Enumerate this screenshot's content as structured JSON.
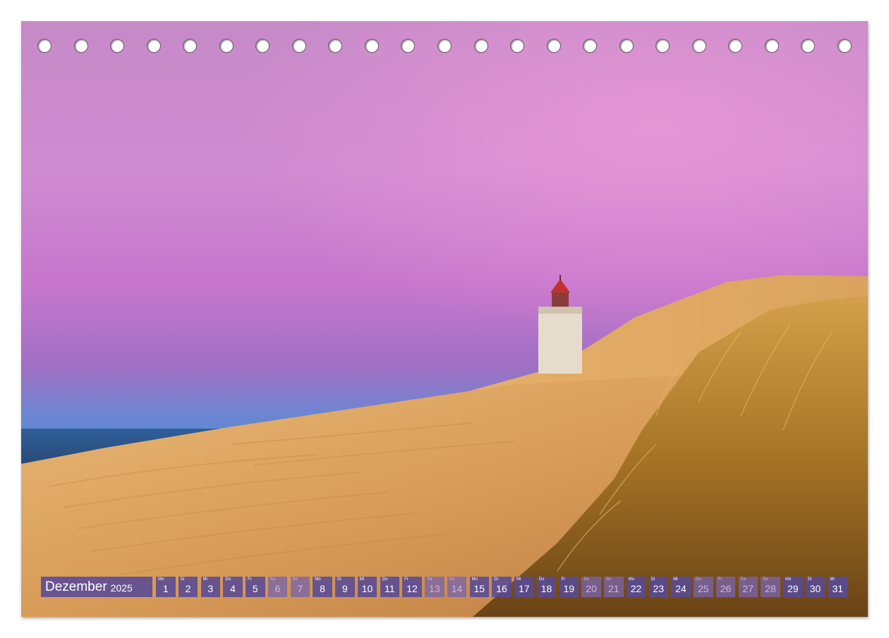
{
  "calendar": {
    "month": "Dezember",
    "year": "2025",
    "days": [
      {
        "wd": "Mo",
        "num": "1",
        "weekend": false
      },
      {
        "wd": "Di",
        "num": "2",
        "weekend": false
      },
      {
        "wd": "Mi",
        "num": "3",
        "weekend": false
      },
      {
        "wd": "Do",
        "num": "4",
        "weekend": false
      },
      {
        "wd": "Fr",
        "num": "5",
        "weekend": false
      },
      {
        "wd": "Sa",
        "num": "6",
        "weekend": true
      },
      {
        "wd": "So",
        "num": "7",
        "weekend": true
      },
      {
        "wd": "Mo",
        "num": "8",
        "weekend": false
      },
      {
        "wd": "Di",
        "num": "9",
        "weekend": false
      },
      {
        "wd": "Mi",
        "num": "10",
        "weekend": false
      },
      {
        "wd": "Do",
        "num": "11",
        "weekend": false
      },
      {
        "wd": "Fr",
        "num": "12",
        "weekend": false
      },
      {
        "wd": "Sa",
        "num": "13",
        "weekend": true
      },
      {
        "wd": "So",
        "num": "14",
        "weekend": true
      },
      {
        "wd": "Mo",
        "num": "15",
        "weekend": false
      },
      {
        "wd": "Di",
        "num": "16",
        "weekend": false
      },
      {
        "wd": "Mi",
        "num": "17",
        "weekend": false
      },
      {
        "wd": "Do",
        "num": "18",
        "weekend": false
      },
      {
        "wd": "Fr",
        "num": "19",
        "weekend": false
      },
      {
        "wd": "Sa",
        "num": "20",
        "weekend": true
      },
      {
        "wd": "So",
        "num": "21",
        "weekend": true
      },
      {
        "wd": "Mo",
        "num": "22",
        "weekend": false
      },
      {
        "wd": "Di",
        "num": "23",
        "weekend": false
      },
      {
        "wd": "Mi",
        "num": "24",
        "weekend": false
      },
      {
        "wd": "Do",
        "num": "25",
        "weekend": true
      },
      {
        "wd": "Fr",
        "num": "26",
        "weekend": true
      },
      {
        "wd": "Sa",
        "num": "27",
        "weekend": true
      },
      {
        "wd": "So",
        "num": "28",
        "weekend": true
      },
      {
        "wd": "Mo",
        "num": "29",
        "weekend": false
      },
      {
        "wd": "Di",
        "num": "30",
        "weekend": false
      },
      {
        "wd": "Mi",
        "num": "31",
        "weekend": false
      }
    ]
  },
  "binding_holes": 23,
  "colors": {
    "calendar_bar": "#584a96",
    "sky_top": "#c77fc8",
    "sand": "#e0a85c"
  }
}
